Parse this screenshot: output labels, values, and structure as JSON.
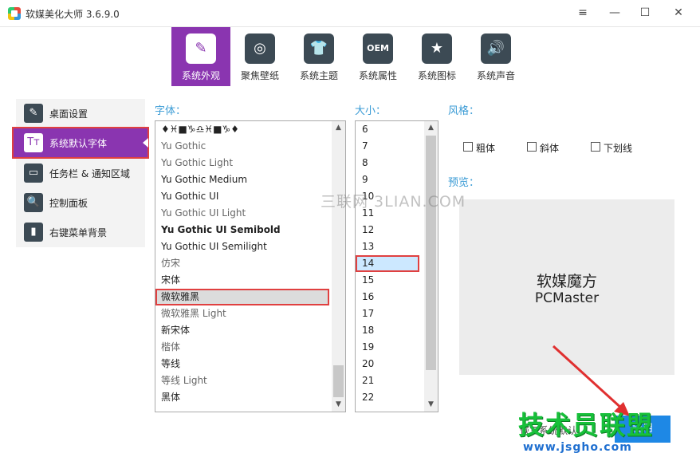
{
  "window": {
    "title": "软媒美化大师 3.6.9.0",
    "menu_icon": "≡",
    "minimize_icon": "—",
    "maximize_icon": "☐",
    "close_icon": "✕"
  },
  "topnav": {
    "items": [
      {
        "label": "系统外观",
        "icon": "brush-icon",
        "glyph": "✎"
      },
      {
        "label": "聚焦壁纸",
        "icon": "target-icon",
        "glyph": "◎"
      },
      {
        "label": "系统主题",
        "icon": "tshirt-icon",
        "glyph": "👕"
      },
      {
        "label": "系统属性",
        "icon": "oem-icon",
        "glyph": "OEM"
      },
      {
        "label": "系统图标",
        "icon": "star-icon",
        "glyph": "★"
      },
      {
        "label": "系统声音",
        "icon": "speaker-icon",
        "glyph": "🔊"
      }
    ]
  },
  "sidebar": {
    "items": [
      {
        "label": "桌面设置",
        "glyph": "✎"
      },
      {
        "label": "系统默认字体",
        "glyph": "Tт"
      },
      {
        "label": "任务栏 & 通知区域",
        "glyph": "▭"
      },
      {
        "label": "控制面板",
        "glyph": "🔍"
      },
      {
        "label": "右键菜单背景",
        "glyph": "▮"
      }
    ]
  },
  "labels": {
    "font": "字体：",
    "size": "大小：",
    "style": "风格：",
    "preview": "预览："
  },
  "fonts": [
    "♦♓■♑♎♓■♑♦",
    "Yu Gothic",
    "Yu Gothic Light",
    "Yu Gothic Medium",
    "Yu Gothic UI",
    "Yu Gothic UI Light",
    "Yu Gothic UI Semibold",
    "Yu Gothic UI Semilight",
    "仿宋",
    "宋体",
    "微软雅黑",
    "微软雅黑 Light",
    "新宋体",
    "楷体",
    "等线",
    "等线 Light",
    "黑体"
  ],
  "sizes": [
    "6",
    "7",
    "8",
    "9",
    "10",
    "11",
    "12",
    "13",
    "14",
    "15",
    "16",
    "17",
    "18",
    "19",
    "20",
    "21",
    "22"
  ],
  "styles": {
    "bold": "粗体",
    "italic": "斜体",
    "underline": "下划线"
  },
  "preview": {
    "line1": "软媒魔方",
    "line2": "PCMaster"
  },
  "footer": {
    "reset": "恢复系统默认",
    "apply": "应用"
  },
  "watermarks": {
    "center": "三联网 3LIAN.COM",
    "brand": "技术员联盟",
    "url": "www.jsgho.com"
  },
  "colors": {
    "accent": "#8a35b0",
    "highlight": "#e04040",
    "label": "#3a9bd5"
  }
}
